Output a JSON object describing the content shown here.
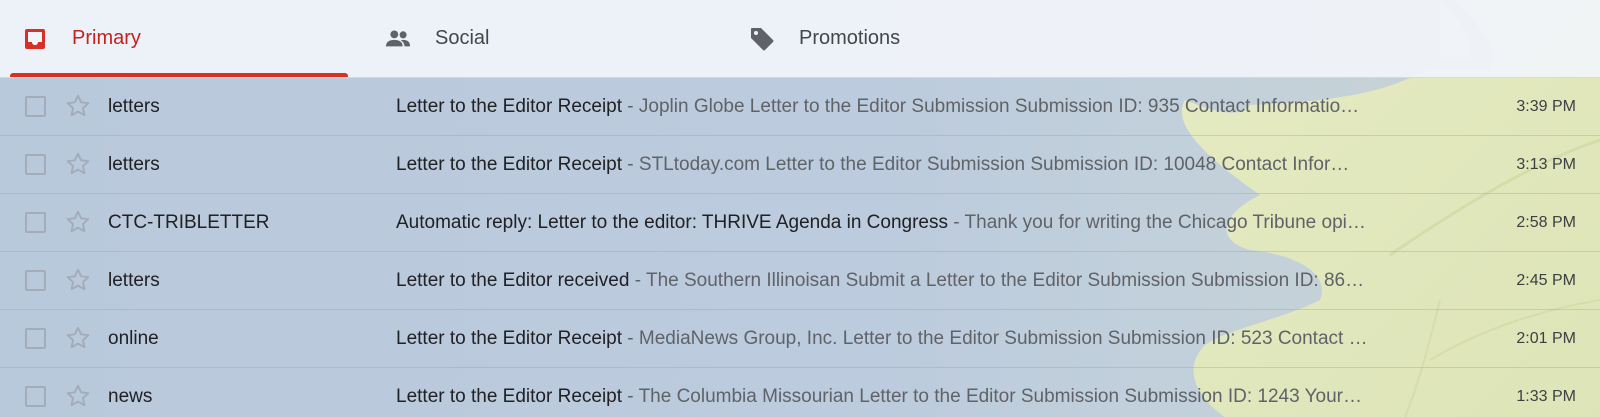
{
  "tabs": [
    {
      "label": "Primary",
      "icon": "inbox-icon",
      "active": true
    },
    {
      "label": "Social",
      "icon": "people-icon",
      "active": false
    },
    {
      "label": "Promotions",
      "icon": "tag-icon",
      "active": false
    }
  ],
  "colors": {
    "accent": "#d93025",
    "active_text": "#c5221f",
    "icon_gray": "#5f6368"
  },
  "emails": [
    {
      "sender": "letters",
      "subject": "Letter to the Editor Receipt",
      "snippet": "Joplin Globe Letter to the Editor Submission Submission ID: 935 Contact Informatio…",
      "time": "3:39 PM"
    },
    {
      "sender": "letters",
      "subject": "Letter to the Editor Receipt",
      "snippet": "STLtoday.com Letter to the Editor Submission Submission ID: 10048 Contact Infor…",
      "time": "3:13 PM"
    },
    {
      "sender": "CTC-TRIBLETTER",
      "subject": "Automatic reply: Letter to the editor: THRIVE Agenda in Congress",
      "snippet": "Thank you for writing the Chicago Tribune opi…",
      "time": "2:58 PM"
    },
    {
      "sender": "letters",
      "subject": "Letter to the Editor received",
      "snippet": "The Southern Illinoisan Submit a Letter to the Editor Submission Submission ID: 86…",
      "time": "2:45 PM"
    },
    {
      "sender": "online",
      "subject": "Letter to the Editor Receipt",
      "snippet": "MediaNews Group, Inc. Letter to the Editor Submission Submission ID: 523 Contact …",
      "time": "2:01 PM"
    },
    {
      "sender": "news",
      "subject": "Letter to the Editor Receipt",
      "snippet": "The Columbia Missourian Letter to the Editor Submission Submission ID: 1243 Your…",
      "time": "1:33 PM"
    }
  ],
  "separator": " - "
}
